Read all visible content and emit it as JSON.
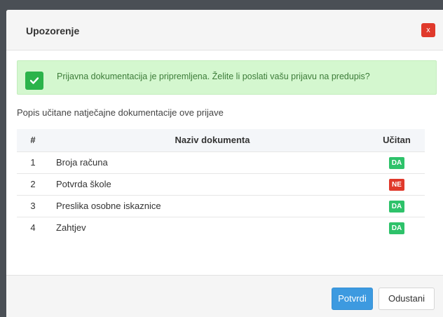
{
  "modal": {
    "title": "Upozorenje",
    "close_label": "x"
  },
  "alert": {
    "icon": "check-icon",
    "message": "Prijavna dokumentacija je pripremljena. Želite li poslati vašu prijavu na predupis?"
  },
  "list_caption": "Popis učitane natječajne dokumentacije ove prijave",
  "table": {
    "headers": [
      "#",
      "Naziv dokumenta",
      "Učitan"
    ],
    "rows": [
      {
        "num": "1",
        "name": "Broja računa",
        "status": "DA"
      },
      {
        "num": "2",
        "name": "Potvrda škole",
        "status": "NE"
      },
      {
        "num": "3",
        "name": "Preslika osobne iskaznice",
        "status": "DA"
      },
      {
        "num": "4",
        "name": "Zahtjev",
        "status": "DA"
      }
    ]
  },
  "colors": {
    "yes": "#2ec26a",
    "no": "#e0392b",
    "primary": "#3d9ae0"
  },
  "footer": {
    "confirm_label": "Potvrdi",
    "cancel_label": "Odustani"
  }
}
